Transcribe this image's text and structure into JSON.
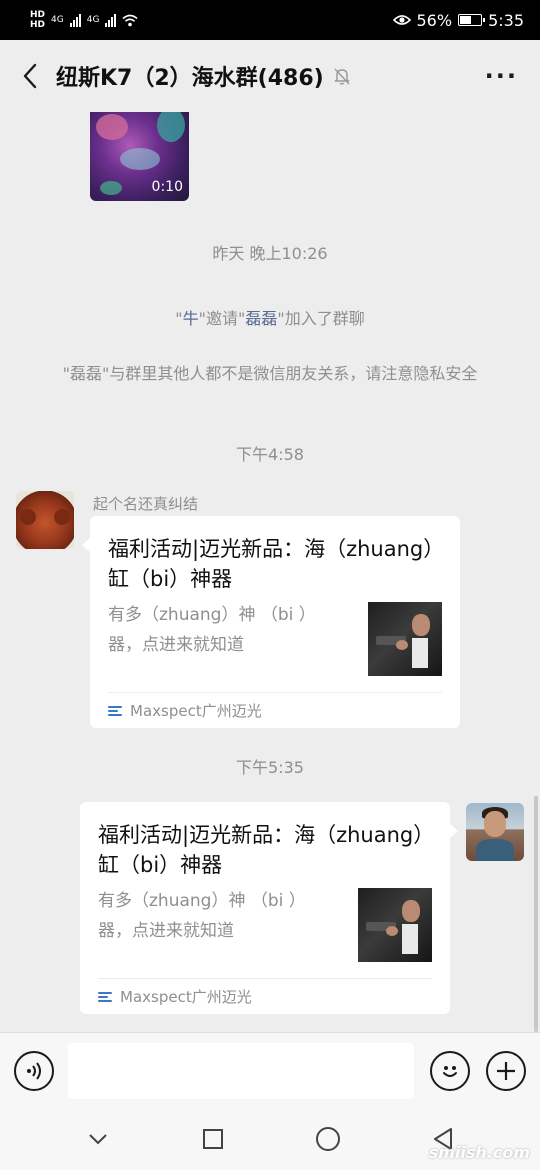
{
  "status_bar": {
    "left_hd": "HD",
    "network": "4G",
    "battery": "56%",
    "battery_level": 0.56,
    "time": "5:35"
  },
  "header": {
    "title": "纽斯K7（2）海水群(486)"
  },
  "messages": {
    "video_duration": "0:10",
    "timestamp1": "昨天 晚上10:26",
    "invite": {
      "q1": "\"",
      "inviter": "牛",
      "mid": "\"邀请\"",
      "invitee": "磊磊",
      "end": "\"加入了群聊"
    },
    "notice": "\"磊磊\"与群里其他人都不是微信朋友关系，请注意隐私安全",
    "timestamp2": "下午4:58",
    "sender": "起个名还真纠结",
    "card1": {
      "title": "福利活动|迈光新品：海（zhuang）缸（bi）神器",
      "desc": "有多（zhuang）神 （bi ）器，点进来就知道",
      "source": "Maxspect广州迈光"
    },
    "timestamp3": "下午5:35",
    "card2": {
      "title": "福利活动|迈光新品：海（zhuang）缸（bi）神器",
      "desc": "有多（zhuang）神 （bi ）器，点进来就知道",
      "source": "Maxspect广州迈光"
    }
  },
  "input": {
    "value": "",
    "placeholder": ""
  },
  "watermark": "smiish.com",
  "icons": {
    "back": "chevron-left-icon",
    "mute": "mute-bell-icon",
    "more": "more-icon",
    "voice": "voice-icon",
    "emoji": "emoji-icon",
    "plus": "plus-icon"
  }
}
